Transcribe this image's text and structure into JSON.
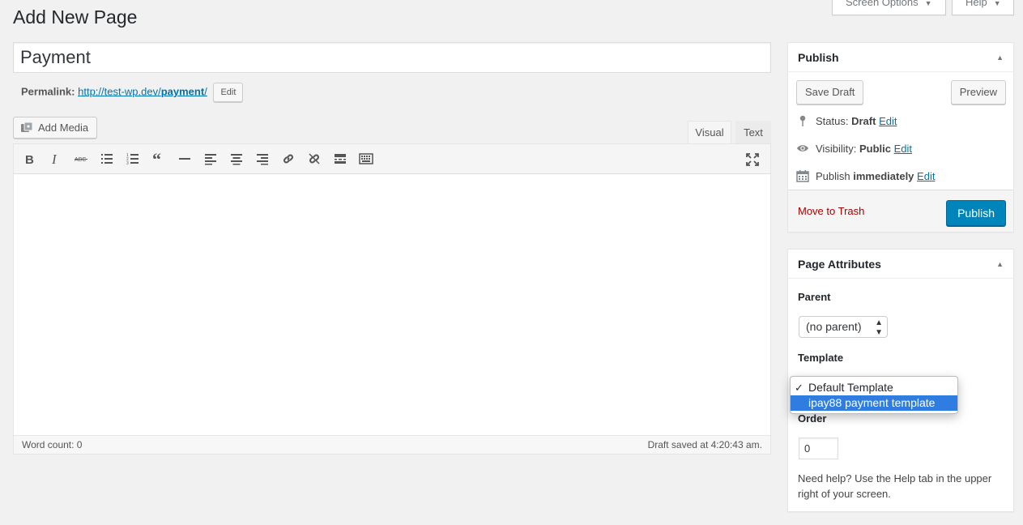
{
  "header": {
    "page_title": "Add New Page",
    "screen_options_label": "Screen Options",
    "help_label": "Help"
  },
  "post": {
    "title_value": "Payment",
    "permalink_label": "Permalink:",
    "permalink_url_prefix": "http://test-wp.dev/",
    "permalink_slug": "payment",
    "permalink_url_suffix": "/",
    "permalink_edit_label": "Edit"
  },
  "editor": {
    "add_media_label": "Add Media",
    "tab_visual": "Visual",
    "tab_text": "Text",
    "word_count": "Word count: 0",
    "draft_saved": "Draft saved at 4:20:43 am.",
    "toolbar_icons": [
      "bold-icon",
      "italic-icon",
      "strikethrough-icon",
      "bulleted-list-icon",
      "numbered-list-icon",
      "blockquote-icon",
      "horizontal-line-icon",
      "align-left-icon",
      "align-center-icon",
      "align-right-icon",
      "link-icon",
      "unlink-icon",
      "read-more-icon",
      "toolbar-toggle-icon",
      "fullscreen-icon"
    ]
  },
  "publish_box": {
    "title": "Publish",
    "save_draft_label": "Save Draft",
    "preview_label": "Preview",
    "status_label": "Status:",
    "status_value": "Draft",
    "visibility_label": "Visibility:",
    "visibility_value": "Public",
    "publish_label": "Publish",
    "publish_value": "immediately",
    "edit_label": "Edit",
    "move_to_trash_label": "Move to Trash",
    "publish_button_label": "Publish"
  },
  "attributes_box": {
    "title": "Page Attributes",
    "parent_label": "Parent",
    "parent_value": "(no parent)",
    "template_label": "Template",
    "template_options": [
      "Default Template",
      "ipay88 payment template"
    ],
    "template_selected_check": "✓",
    "order_label": "Order",
    "order_value": "0",
    "help_text": "Need help? Use the Help tab in the upper right of your screen."
  },
  "colors": {
    "primary_button": "#0085ba",
    "link": "#0073aa",
    "trash": "#a00",
    "dropdown_highlight": "#2f7de1"
  }
}
